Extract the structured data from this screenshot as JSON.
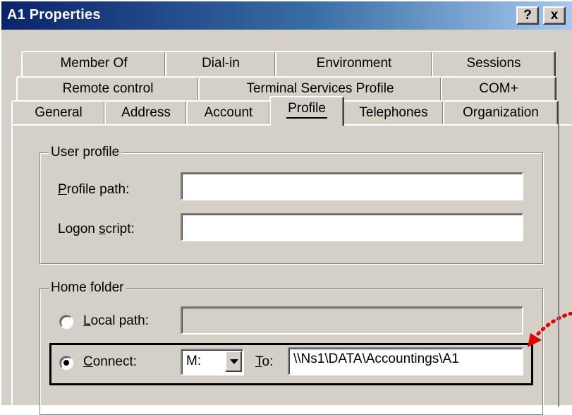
{
  "window": {
    "title": "A1 Properties",
    "help_button": "?",
    "close_button": "x"
  },
  "tabs": {
    "row1": [
      "Member Of",
      "Dial-in",
      "Environment",
      "Sessions"
    ],
    "row2": [
      "Remote control",
      "Terminal Services Profile",
      "COM+"
    ],
    "row3": [
      "General",
      "Address",
      "Account",
      "Profile",
      "Telephones",
      "Organization"
    ],
    "active": "Profile"
  },
  "user_profile": {
    "group_label": "User profile",
    "profile_path_label": "Profile path:",
    "profile_path_value": "",
    "logon_script_label": "Logon script:",
    "logon_script_value": ""
  },
  "home_folder": {
    "group_label": "Home folder",
    "local_path_label": "Local path:",
    "local_path_value": "",
    "local_path_selected": false,
    "connect_label": "Connect:",
    "connect_selected": true,
    "drive_value": "M:",
    "to_label": "To:",
    "to_value": "\\\\Ns1\\DATA\\Accountings\\A1"
  },
  "colors": {
    "title_gradient_start": "#0a246a",
    "title_gradient_end": "#a6caf0",
    "dialog_face": "#d4d0c8",
    "annotation_arrow": "#e00000"
  }
}
